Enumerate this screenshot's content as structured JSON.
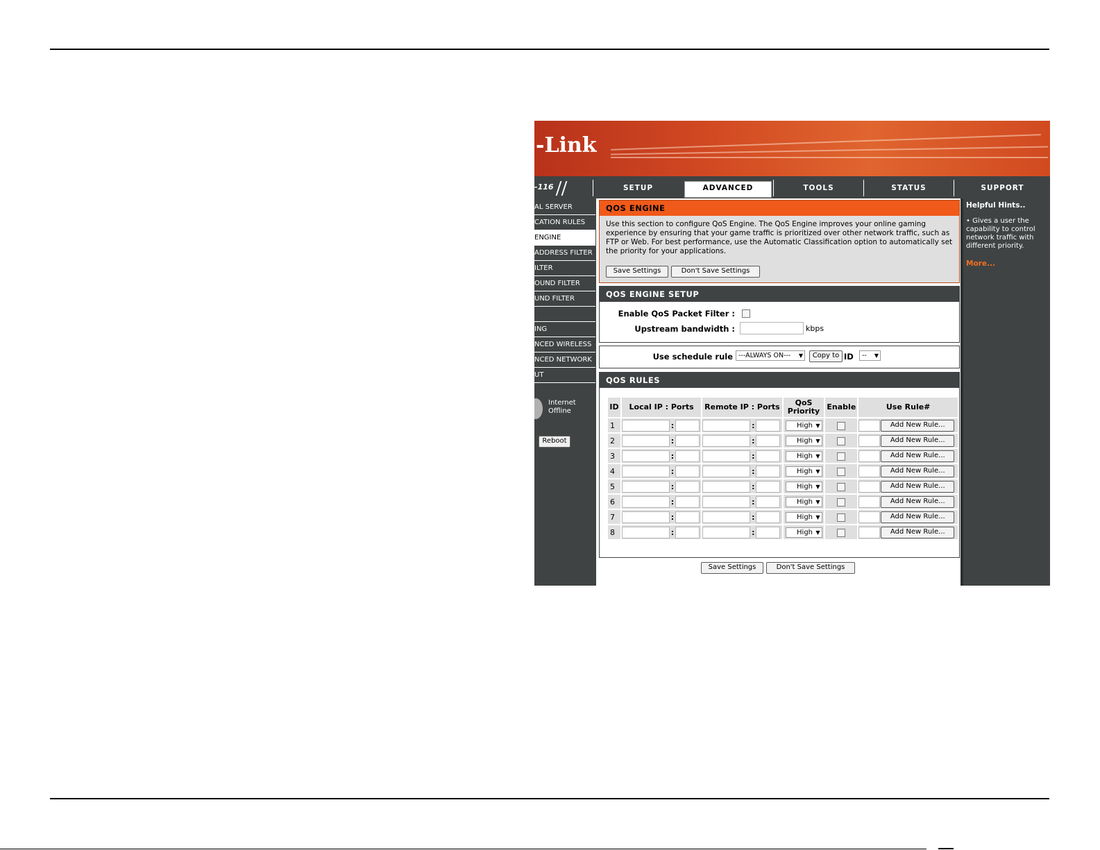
{
  "brand": {
    "logo_text": "-Link",
    "model": "-116"
  },
  "nav": {
    "tabs": [
      {
        "label": "SETUP"
      },
      {
        "label": "ADVANCED"
      },
      {
        "label": "TOOLS"
      },
      {
        "label": "STATUS"
      },
      {
        "label": "SUPPORT"
      }
    ],
    "active_tab": "ADVANCED"
  },
  "sidebar": {
    "items": [
      {
        "label": "AL SERVER"
      },
      {
        "label": "CATION RULES"
      },
      {
        "label": "ENGINE"
      },
      {
        "label": "ADDRESS FILTER"
      },
      {
        "label": "ILTER"
      },
      {
        "label": "OUND FILTER"
      },
      {
        "label": "UND FILTER"
      },
      {
        "label": ""
      },
      {
        "label": "ING"
      },
      {
        "label": "NCED WIRELESS"
      },
      {
        "label": "NCED NETWORK"
      },
      {
        "label": "UT"
      }
    ],
    "status_line1": "Internet",
    "status_line2": "Offline",
    "reboot_label": "Reboot"
  },
  "qos_engine": {
    "title": "QOS ENGINE",
    "description": "Use this section to configure QoS Engine. The QoS Engine improves your online gaming experience by ensuring that your game traffic is prioritized over other network traffic, such as FTP or Web. For best performance, use the Automatic Classification option to automatically set the priority for your applications.",
    "save_label": "Save Settings",
    "dont_save_label": "Don't Save Settings"
  },
  "qos_setup": {
    "title": "QOS ENGINE SETUP",
    "enable_label": "Enable QoS Packet Filter :",
    "enable_checked": false,
    "upstream_label": "Upstream bandwidth :",
    "upstream_value": "",
    "upstream_unit": "kbps"
  },
  "schedule": {
    "label": "Use schedule rule",
    "selected": "---ALWAYS ON---",
    "copy_label": "Copy to",
    "id_label": "ID",
    "id_selected": "--"
  },
  "qos_rules": {
    "title": "QOS RULES",
    "headers": {
      "id": "ID",
      "local": "Local IP : Ports",
      "remote": "Remote IP : Ports",
      "priority_line1": "QoS",
      "priority_line2": "Priority",
      "enable": "Enable",
      "use_rule": "Use Rule#"
    },
    "colon": ":",
    "add_rule_label": "Add New Rule...",
    "rows": [
      {
        "id": "1",
        "priority": "High",
        "enabled": false
      },
      {
        "id": "2",
        "priority": "High",
        "enabled": false
      },
      {
        "id": "3",
        "priority": "High",
        "enabled": false
      },
      {
        "id": "4",
        "priority": "High",
        "enabled": false
      },
      {
        "id": "5",
        "priority": "High",
        "enabled": false
      },
      {
        "id": "6",
        "priority": "High",
        "enabled": false
      },
      {
        "id": "7",
        "priority": "High",
        "enabled": false
      },
      {
        "id": "8",
        "priority": "High",
        "enabled": false
      }
    ]
  },
  "bottom_buttons": {
    "save_label": "Save Settings",
    "dont_save_label": "Don't Save Settings"
  },
  "hints": {
    "title": "Helpful Hints..",
    "bullet": "• Gives a user the capability to control network traffic with different priority.",
    "more_label": "More..."
  },
  "colors": {
    "banner": "#d24a22",
    "accent": "#f05a1a",
    "dark": "#404343",
    "link": "#f07020"
  }
}
